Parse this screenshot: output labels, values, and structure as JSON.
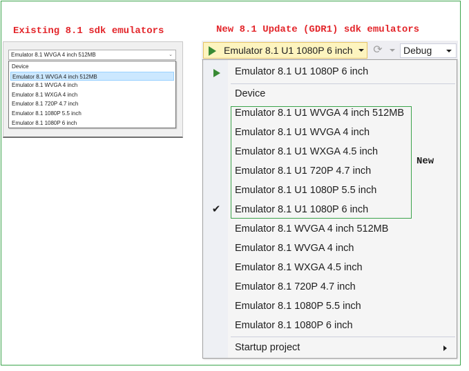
{
  "captions": {
    "existing": "Existing 8.1 sdk emulators",
    "new_update": "New 8.1 Update (GDR1) sdk emulators",
    "new_badge": "New"
  },
  "old_dropdown": {
    "selected": "Emulator 8.1 WVGA 4 inch 512MB",
    "items": [
      "Device",
      "Emulator 8.1 WVGA 4 inch 512MB",
      "Emulator 8.1 WVGA 4 inch",
      "Emulator 8.1 WXGA 4 inch",
      "Emulator 8.1 720P 4.7 inch",
      "Emulator 8.1 1080P 5.5 inch",
      "Emulator 8.1 1080P 6 inch"
    ],
    "highlighted_index": 1
  },
  "toolbar": {
    "run_target": "Emulator 8.1 U1 1080P 6 inch",
    "configuration": "Debug",
    "icons": [
      "play-icon",
      "refresh-icon",
      "dropdown-caret-icon"
    ]
  },
  "menu": {
    "recent": "Emulator 8.1 U1 1080P 6 inch",
    "device": "Device",
    "new_items": [
      "Emulator 8.1 U1 WVGA 4 inch 512MB",
      "Emulator 8.1 U1 WVGA 4 inch",
      "Emulator 8.1 U1 WXGA 4.5 inch",
      "Emulator 8.1 U1 720P 4.7 inch",
      "Emulator 8.1 U1 1080P 5.5 inch",
      "Emulator 8.1 U1 1080P 6 inch"
    ],
    "checked_index": 5,
    "old_items": [
      "Emulator 8.1 WVGA 4 inch 512MB",
      "Emulator 8.1 WVGA 4 inch",
      "Emulator 8.1 WXGA 4.5 inch",
      "Emulator 8.1 720P 4.7 inch",
      "Emulator 8.1 1080P 5.5 inch",
      "Emulator 8.1 1080P 6 inch"
    ],
    "startup_project": "Startup project"
  },
  "colors": {
    "caption_red": "#e3262b",
    "highlight_green": "#3aa34a",
    "play_green": "#388a34",
    "run_button_bg": "#fdf4bf",
    "old_selected_bg": "#cce8ff"
  }
}
